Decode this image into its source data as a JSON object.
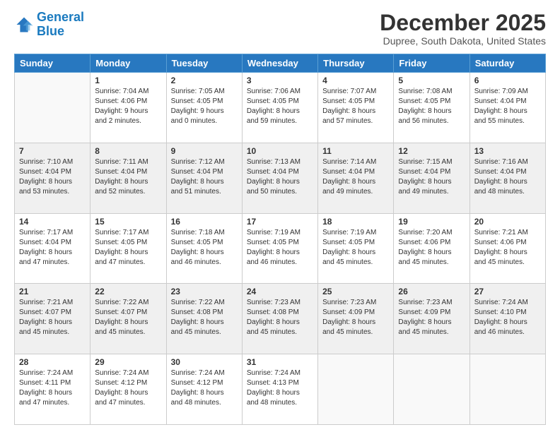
{
  "logo": {
    "line1": "General",
    "line2": "Blue"
  },
  "title": "December 2025",
  "subtitle": "Dupree, South Dakota, United States",
  "days": [
    "Sunday",
    "Monday",
    "Tuesday",
    "Wednesday",
    "Thursday",
    "Friday",
    "Saturday"
  ],
  "weeks": [
    [
      {
        "num": "",
        "sunrise": "",
        "sunset": "",
        "daylight": ""
      },
      {
        "num": "1",
        "sunrise": "Sunrise: 7:04 AM",
        "sunset": "Sunset: 4:06 PM",
        "daylight": "Daylight: 9 hours and 2 minutes."
      },
      {
        "num": "2",
        "sunrise": "Sunrise: 7:05 AM",
        "sunset": "Sunset: 4:05 PM",
        "daylight": "Daylight: 9 hours and 0 minutes."
      },
      {
        "num": "3",
        "sunrise": "Sunrise: 7:06 AM",
        "sunset": "Sunset: 4:05 PM",
        "daylight": "Daylight: 8 hours and 59 minutes."
      },
      {
        "num": "4",
        "sunrise": "Sunrise: 7:07 AM",
        "sunset": "Sunset: 4:05 PM",
        "daylight": "Daylight: 8 hours and 57 minutes."
      },
      {
        "num": "5",
        "sunrise": "Sunrise: 7:08 AM",
        "sunset": "Sunset: 4:05 PM",
        "daylight": "Daylight: 8 hours and 56 minutes."
      },
      {
        "num": "6",
        "sunrise": "Sunrise: 7:09 AM",
        "sunset": "Sunset: 4:04 PM",
        "daylight": "Daylight: 8 hours and 55 minutes."
      }
    ],
    [
      {
        "num": "7",
        "sunrise": "Sunrise: 7:10 AM",
        "sunset": "Sunset: 4:04 PM",
        "daylight": "Daylight: 8 hours and 53 minutes."
      },
      {
        "num": "8",
        "sunrise": "Sunrise: 7:11 AM",
        "sunset": "Sunset: 4:04 PM",
        "daylight": "Daylight: 8 hours and 52 minutes."
      },
      {
        "num": "9",
        "sunrise": "Sunrise: 7:12 AM",
        "sunset": "Sunset: 4:04 PM",
        "daylight": "Daylight: 8 hours and 51 minutes."
      },
      {
        "num": "10",
        "sunrise": "Sunrise: 7:13 AM",
        "sunset": "Sunset: 4:04 PM",
        "daylight": "Daylight: 8 hours and 50 minutes."
      },
      {
        "num": "11",
        "sunrise": "Sunrise: 7:14 AM",
        "sunset": "Sunset: 4:04 PM",
        "daylight": "Daylight: 8 hours and 49 minutes."
      },
      {
        "num": "12",
        "sunrise": "Sunrise: 7:15 AM",
        "sunset": "Sunset: 4:04 PM",
        "daylight": "Daylight: 8 hours and 49 minutes."
      },
      {
        "num": "13",
        "sunrise": "Sunrise: 7:16 AM",
        "sunset": "Sunset: 4:04 PM",
        "daylight": "Daylight: 8 hours and 48 minutes."
      }
    ],
    [
      {
        "num": "14",
        "sunrise": "Sunrise: 7:17 AM",
        "sunset": "Sunset: 4:04 PM",
        "daylight": "Daylight: 8 hours and 47 minutes."
      },
      {
        "num": "15",
        "sunrise": "Sunrise: 7:17 AM",
        "sunset": "Sunset: 4:05 PM",
        "daylight": "Daylight: 8 hours and 47 minutes."
      },
      {
        "num": "16",
        "sunrise": "Sunrise: 7:18 AM",
        "sunset": "Sunset: 4:05 PM",
        "daylight": "Daylight: 8 hours and 46 minutes."
      },
      {
        "num": "17",
        "sunrise": "Sunrise: 7:19 AM",
        "sunset": "Sunset: 4:05 PM",
        "daylight": "Daylight: 8 hours and 46 minutes."
      },
      {
        "num": "18",
        "sunrise": "Sunrise: 7:19 AM",
        "sunset": "Sunset: 4:05 PM",
        "daylight": "Daylight: 8 hours and 45 minutes."
      },
      {
        "num": "19",
        "sunrise": "Sunrise: 7:20 AM",
        "sunset": "Sunset: 4:06 PM",
        "daylight": "Daylight: 8 hours and 45 minutes."
      },
      {
        "num": "20",
        "sunrise": "Sunrise: 7:21 AM",
        "sunset": "Sunset: 4:06 PM",
        "daylight": "Daylight: 8 hours and 45 minutes."
      }
    ],
    [
      {
        "num": "21",
        "sunrise": "Sunrise: 7:21 AM",
        "sunset": "Sunset: 4:07 PM",
        "daylight": "Daylight: 8 hours and 45 minutes."
      },
      {
        "num": "22",
        "sunrise": "Sunrise: 7:22 AM",
        "sunset": "Sunset: 4:07 PM",
        "daylight": "Daylight: 8 hours and 45 minutes."
      },
      {
        "num": "23",
        "sunrise": "Sunrise: 7:22 AM",
        "sunset": "Sunset: 4:08 PM",
        "daylight": "Daylight: 8 hours and 45 minutes."
      },
      {
        "num": "24",
        "sunrise": "Sunrise: 7:23 AM",
        "sunset": "Sunset: 4:08 PM",
        "daylight": "Daylight: 8 hours and 45 minutes."
      },
      {
        "num": "25",
        "sunrise": "Sunrise: 7:23 AM",
        "sunset": "Sunset: 4:09 PM",
        "daylight": "Daylight: 8 hours and 45 minutes."
      },
      {
        "num": "26",
        "sunrise": "Sunrise: 7:23 AM",
        "sunset": "Sunset: 4:09 PM",
        "daylight": "Daylight: 8 hours and 45 minutes."
      },
      {
        "num": "27",
        "sunrise": "Sunrise: 7:24 AM",
        "sunset": "Sunset: 4:10 PM",
        "daylight": "Daylight: 8 hours and 46 minutes."
      }
    ],
    [
      {
        "num": "28",
        "sunrise": "Sunrise: 7:24 AM",
        "sunset": "Sunset: 4:11 PM",
        "daylight": "Daylight: 8 hours and 47 minutes."
      },
      {
        "num": "29",
        "sunrise": "Sunrise: 7:24 AM",
        "sunset": "Sunset: 4:12 PM",
        "daylight": "Daylight: 8 hours and 47 minutes."
      },
      {
        "num": "30",
        "sunrise": "Sunrise: 7:24 AM",
        "sunset": "Sunset: 4:12 PM",
        "daylight": "Daylight: 8 hours and 48 minutes."
      },
      {
        "num": "31",
        "sunrise": "Sunrise: 7:24 AM",
        "sunset": "Sunset: 4:13 PM",
        "daylight": "Daylight: 8 hours and 48 minutes."
      },
      {
        "num": "",
        "sunrise": "",
        "sunset": "",
        "daylight": ""
      },
      {
        "num": "",
        "sunrise": "",
        "sunset": "",
        "daylight": ""
      },
      {
        "num": "",
        "sunrise": "",
        "sunset": "",
        "daylight": ""
      }
    ]
  ]
}
